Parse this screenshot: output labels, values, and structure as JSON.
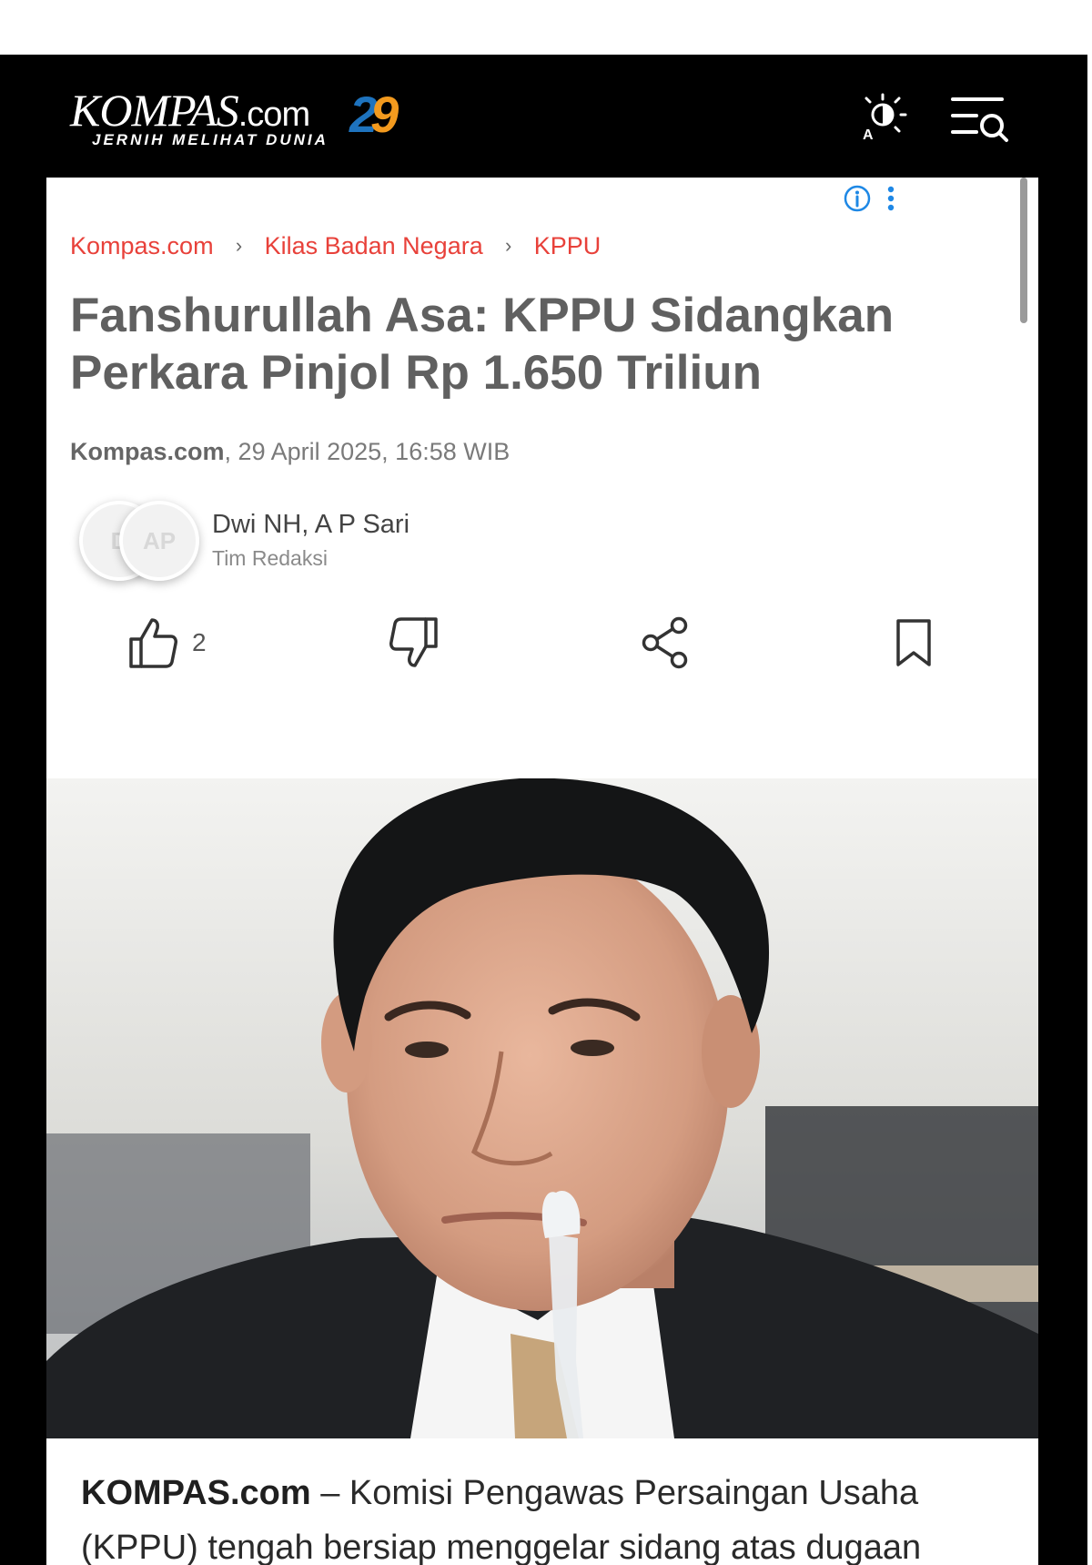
{
  "header": {
    "logo_text": "KOMPAS",
    "logo_suffix": ".com",
    "logo_tagline": "JERNIH MELIHAT DUNIA",
    "anniversary_digit_1": "2",
    "anniversary_digit_2": "9",
    "theme_icon": "contrast-brightness-icon",
    "menu_icon": "menu-search-icon"
  },
  "ad": {
    "info_icon": "info-icon",
    "more_icon": "more-vertical-icon"
  },
  "breadcrumb": {
    "items": [
      "Kompas.com",
      "Kilas Badan Negara",
      "KPPU"
    ],
    "separator": "›"
  },
  "article": {
    "title": "Fanshurullah Asa: KPPU Sidangkan Perkara Pinjol Rp 1.650 Triliun",
    "source": "Kompas.com",
    "date": ", 29 April 2025, 16:58 WIB",
    "authors": {
      "avatars": [
        "D",
        "AP"
      ],
      "names": "Dwi NH, A P Sari",
      "role": "Tim Redaksi"
    },
    "actions": {
      "like_count": "2",
      "like_icon": "thumbs-up-icon",
      "dislike_icon": "thumbs-down-icon",
      "share_icon": "share-icon",
      "bookmark_icon": "bookmark-icon"
    },
    "lead_source": "KOMPAS.com",
    "lead_text": " – Komisi Pengawas Persaingan Usaha (KPPU) tengah bersiap menggelar sidang atas dugaan praktik kartel suku bunga di industri pinjaman online"
  },
  "colors": {
    "breadcrumb": "#e8413a",
    "header_bg": "#000000",
    "ad_icon": "#1e88e5"
  }
}
